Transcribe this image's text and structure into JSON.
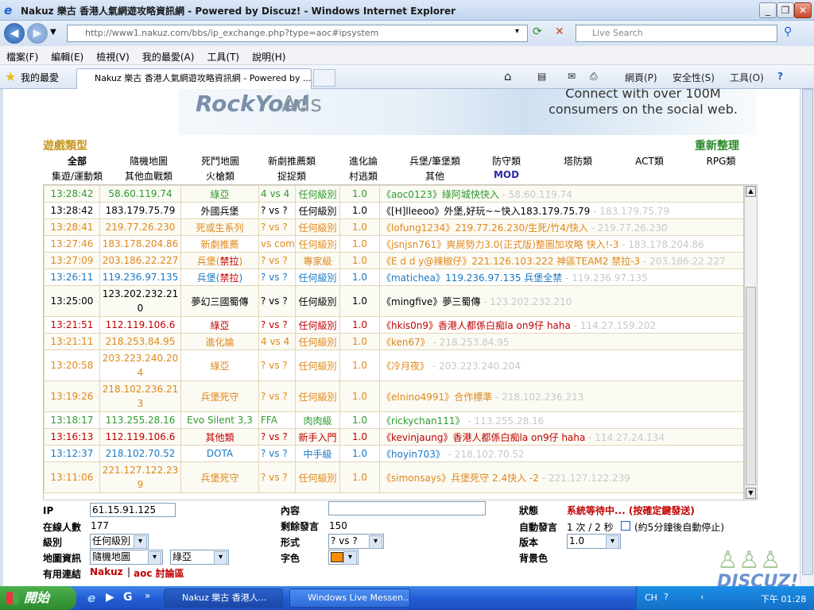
{
  "window": {
    "title": "Nakuz 樂古 香港人氣網遊攻略資訊網 - Powered by Discuz! - Windows Internet Explorer",
    "address": "http://www1.nakuz.com/bbs/ip_exchange.php?type=aoc#ipsystem",
    "search_placeholder": "Live Search"
  },
  "menu": [
    "檔案(F)",
    "編輯(E)",
    "檢視(V)",
    "我的最愛(A)",
    "工具(T)",
    "說明(H)"
  ],
  "favbar": {
    "favorites": "我的最愛",
    "tab_title": "Nakuz 樂古 香港人氣網遊攻略資訊網 - Powered by ...",
    "tools": [
      "網頁(P)",
      "安全性(S)",
      "工具(O)"
    ]
  },
  "banner": {
    "logo": "RockYou!",
    "ads": "Ads",
    "tagline": "Connect with over 100M consumers on the social web."
  },
  "categories": {
    "label": "遊戲類型",
    "refresh": "重新整理",
    "row1": [
      "全部",
      "隨機地圖",
      "死鬥地圖",
      "新劇推薦類",
      "進化論",
      "兵堡/筆堡類",
      "防守類",
      "塔防類",
      "ACT類",
      "RPG類"
    ],
    "row2": [
      "集遊/運動類",
      "其他血戰類",
      "火槍類",
      "捉捉類",
      "村逃類",
      "其他",
      "MOD"
    ]
  },
  "colors": {
    "green": "#2e9a2e",
    "black": "#000000",
    "orange": "#e0881a",
    "blue": "#1a78c2",
    "red": "#c00000"
  },
  "chat": [
    {
      "time": "13:28:42",
      "ip": "58.60.119.74",
      "game": "綠亞",
      "mode": "4 vs 4",
      "level": "任何級別",
      "ver": "1.0",
      "user": "aoc0123",
      "text": "綠阿城快快入",
      "ipshow": " - 58.60.119.74",
      "color": "green",
      "h": 21
    },
    {
      "time": "13:28:42",
      "ip": "183.179.75.79",
      "game": "外國兵堡",
      "mode": "? vs ?",
      "level": "任何級別",
      "ver": "1.0",
      "user": "[H]lleeoo",
      "text": "外堡,好玩~~快入183.179.75.79",
      "ipshow": " - 183.179.75.79",
      "color": "black",
      "h": 21
    },
    {
      "time": "13:28:41",
      "ip": "219.77.26.230",
      "game": "死或生系列",
      "mode": "? vs ?",
      "level": "任何級別",
      "ver": "1.0",
      "user": "lofung1234",
      "text": "219.77.26.230/生死/竹4/快入",
      "ipshow": " - 219.77.26.230",
      "color": "orange",
      "h": 21
    },
    {
      "time": "13:27:46",
      "ip": "183.178.204.86",
      "game": "新劇推薦",
      "mode": "vs com",
      "level": "任何級別",
      "ver": "1.0",
      "user": "jsnjsn761",
      "text": "爽屍勢力3.0(正式版)整圖加攻略 快入!-3",
      "ipshow": " - 183.178.204.86",
      "color": "orange",
      "h": 21
    },
    {
      "time": "13:27:09",
      "ip": "203.186.22.227",
      "game": "兵堡(禁拉)",
      "mode": "? vs ?",
      "level": "專家級",
      "ver": "1.0",
      "user": "E d d y@辣椒仔",
      "text": "221.126.103.222 神區TEAM2 禁拉-3",
      "ipshow": " - 203.186.22.227",
      "color": "orange",
      "h": 21
    },
    {
      "time": "13:26:11",
      "ip": "119.236.97.135",
      "game": "兵堡(禁拉)",
      "mode": "? vs ?",
      "level": "任何級別",
      "ver": "1.0",
      "user": "matichea",
      "text": "119.236.97.135 兵堡全禁",
      "ipshow": " - 119.236.97.135",
      "color": "blue",
      "h": 21
    },
    {
      "time": "13:25:00",
      "ip": "123.202.232.210",
      "game": "夢幻三國蜀傳",
      "mode": "? vs ?",
      "level": "任何級別",
      "ver": "1.0",
      "user": "mingfive",
      "text": "夢三蜀傳",
      "ipshow": " - 123.202.232.210",
      "color": "black",
      "h": 39
    },
    {
      "time": "13:21:51",
      "ip": "112.119.106.6",
      "game": "綠亞",
      "mode": "? vs ?",
      "level": "任何級別",
      "ver": "1.0",
      "user": "hkis0n9",
      "text": "香港人都係白痴la on9仔 haha",
      "ipshow": " - 114.27.159.202",
      "color": "red",
      "h": 21
    },
    {
      "time": "13:21:11",
      "ip": "218.253.84.95",
      "game": "進化論",
      "mode": "4 vs 4",
      "level": "任何級別",
      "ver": "1.0",
      "user": "ken67",
      "text": "",
      "ipshow": " - 218.253.84.95",
      "color": "orange",
      "h": 21
    },
    {
      "time": "13:20:58",
      "ip": "203.223.240.204",
      "game": "綠亞",
      "mode": "? vs ?",
      "level": "任何級別",
      "ver": "1.0",
      "user": "冷月夜",
      "text": "",
      "ipshow": " - 203.223.240.204",
      "color": "orange",
      "h": 39
    },
    {
      "time": "13:19:26",
      "ip": "218.102.236.213",
      "game": "兵堡死守",
      "mode": "? vs ?",
      "level": "任何級別",
      "ver": "1.0",
      "user": "elnino4991",
      "text": "合作標準",
      "ipshow": " - 218.102.236.213",
      "color": "orange",
      "h": 39
    },
    {
      "time": "13:18:17",
      "ip": "113.255.28.16",
      "game": "Evo Silent 3,3",
      "mode": "FFA",
      "level": "肉肉級",
      "ver": "1.0",
      "user": "rickychan111",
      "text": "",
      "ipshow": " - 113.255.28.16",
      "color": "green",
      "h": 21
    },
    {
      "time": "13:16:13",
      "ip": "112.119.106.6",
      "game": "其他類",
      "mode": "? vs ?",
      "level": "新手入門",
      "ver": "1.0",
      "user": "kevinjaung",
      "text": "香港人都係白痴la on9仔 haha",
      "ipshow": " - 114.27.24.134",
      "color": "red",
      "h": 21
    },
    {
      "time": "13:12:37",
      "ip": "218.102.70.52",
      "game": "DOTA",
      "mode": "? vs ?",
      "level": "中手級",
      "ver": "1.0",
      "user": "hoyin703",
      "text": "",
      "ipshow": " - 218.102.70.52",
      "color": "blue",
      "h": 21
    },
    {
      "time": "13:11:06",
      "ip": "221.127.122.239",
      "game": "兵堡死守",
      "mode": "? vs ?",
      "level": "任何級別",
      "ver": "1.0",
      "user": "simonsays",
      "text": "兵堡死守 2.4快入 -2",
      "ipshow": " - 221.127.122.239",
      "color": "orange",
      "h": 39
    }
  ],
  "form": {
    "ip_label": "IP",
    "ip_value": "61.15.91.125",
    "online_label": "在線人數",
    "online_value": "177",
    "level_label": "級別",
    "level_value": "任何級別",
    "map_label": "地圖資訊",
    "map_value1": "隨機地圖",
    "map_value2": "綠亞",
    "links_label": "有用連結",
    "link1": "Nakuz",
    "link_sep": "|",
    "link2": "aoc 討論區",
    "content_label": "內容",
    "remaining_label": "剩餘發言",
    "remaining_value": "150",
    "format_label": "形式",
    "format_value": "? vs ?",
    "color_label": "字色",
    "color_value": "#ff8c00",
    "status_label": "狀態",
    "status_value": "系統等待中... (按確定鍵發送)",
    "auto_label": "自動發言",
    "auto_value": "1 次 / 2 秒",
    "auto_note": "(約5分鐘後自動停止)",
    "version_label": "版本",
    "version_value": "1.0",
    "bg_label": "背景色"
  },
  "taskbar": {
    "start": "開始",
    "task1": "Nakuz 樂古 香港人...",
    "task2": "Windows Live Messen...",
    "lang": "CH",
    "clock": "下午 01:28"
  },
  "watermark": "DISCUZ!"
}
